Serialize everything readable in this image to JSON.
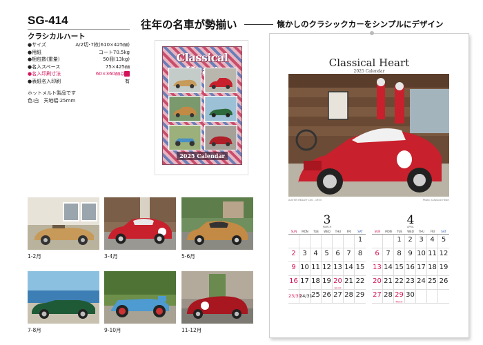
{
  "product": {
    "code": "SG-414",
    "name": "クラシカルハート",
    "specs": [
      {
        "k": "●サイズ",
        "v": "A/2切･7枚(610×425㎜)",
        "hl": false
      },
      {
        "k": "●用紙",
        "v": "コート70.5kg",
        "hl": false
      },
      {
        "k": "●梱包数(重量)",
        "v": "50冊(13kg)",
        "hl": false
      },
      {
        "k": "●名入スペース",
        "v": "75×425㎜",
        "hl": false
      },
      {
        "k": "●名入印刷寸法",
        "v": "60×360㎜以内",
        "hl": true
      },
      {
        "k": "●表紙名入印刷",
        "v": "有",
        "hl": false
      }
    ],
    "note1": "ホットメルト製品です",
    "note2": "色:白　天地幅:25mm"
  },
  "headline": {
    "main": "往年の名車が勢揃い",
    "sub": "懐かしのクラシックカーをシンプルにデザイン"
  },
  "cover": {
    "title": "Classical Heart",
    "year": "2025 Calendar"
  },
  "thumbs": [
    {
      "label": "1-2月"
    },
    {
      "label": "3-4月"
    },
    {
      "label": "5-6月"
    },
    {
      "label": "7-8月"
    },
    {
      "label": "9-10月"
    },
    {
      "label": "11-12月"
    }
  ],
  "calendar": {
    "title": "Classical Heart",
    "subtitle": "2025 Calendar",
    "caption_left": "AUSTIN HEALEY 100 - 1953",
    "caption_right": "Photo: Classical Heart",
    "weekdays": [
      "SUN",
      "MON",
      "TUE",
      "WED",
      "THU",
      "FRI",
      "SAT"
    ],
    "months": [
      {
        "num": "3",
        "en": "MARCH",
        "rows": [
          [
            "",
            "",
            "",
            "",
            "",
            "",
            "1"
          ],
          [
            "2",
            "3",
            "4",
            "5",
            "6",
            "7",
            "8"
          ],
          [
            "9",
            "10",
            "11",
            "12",
            "13",
            "14",
            "15"
          ],
          [
            "16",
            "17",
            "18",
            "19",
            "20",
            "21",
            "22"
          ],
          [
            "23/30",
            "24/31",
            "25",
            "26",
            "27",
            "28",
            "29"
          ]
        ],
        "holidays": [
          "20"
        ],
        "labels": {
          "20": "春分の日"
        }
      },
      {
        "num": "4",
        "en": "APRIL",
        "rows": [
          [
            "",
            "",
            "1",
            "2",
            "3",
            "4",
            "5"
          ],
          [
            "6",
            "7",
            "8",
            "9",
            "10",
            "11",
            "12"
          ],
          [
            "13",
            "14",
            "15",
            "16",
            "17",
            "18",
            "19"
          ],
          [
            "20",
            "21",
            "22",
            "23",
            "24",
            "25",
            "26"
          ],
          [
            "27",
            "28",
            "29",
            "30",
            "",
            "",
            ""
          ]
        ],
        "holidays": [
          "29"
        ],
        "labels": {
          "29": "昭和の日"
        }
      }
    ]
  }
}
